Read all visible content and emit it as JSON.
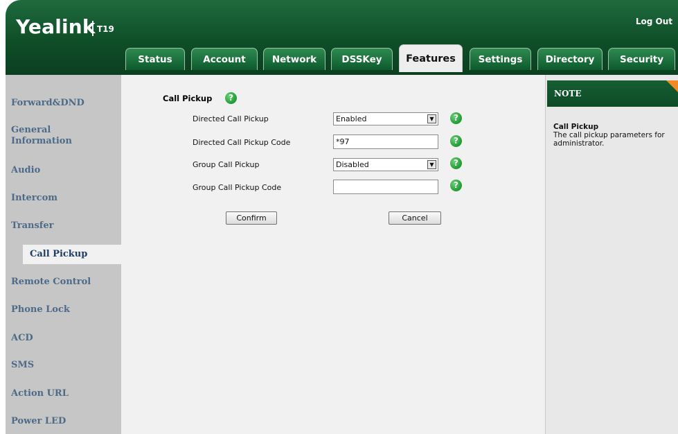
{
  "brand": {
    "name": "Yealink",
    "model": "T19"
  },
  "header": {
    "logout_label": "Log Out"
  },
  "tabs": [
    {
      "label": "Status",
      "active": false
    },
    {
      "label": "Account",
      "active": false
    },
    {
      "label": "Network",
      "active": false
    },
    {
      "label": "DSSKey",
      "active": false
    },
    {
      "label": "Features",
      "active": true
    },
    {
      "label": "Settings",
      "active": false
    },
    {
      "label": "Directory",
      "active": false
    },
    {
      "label": "Security",
      "active": false
    }
  ],
  "sidebar": {
    "items": [
      {
        "label": "Forward&DND"
      },
      {
        "label": "General\nInformation"
      },
      {
        "label": "Audio"
      },
      {
        "label": "Intercom"
      },
      {
        "label": "Transfer"
      },
      {
        "label": "Call Pickup",
        "active": true
      },
      {
        "label": "Remote Control"
      },
      {
        "label": "Phone Lock"
      },
      {
        "label": "ACD"
      },
      {
        "label": "SMS"
      },
      {
        "label": "Action URL"
      },
      {
        "label": "Power LED"
      }
    ]
  },
  "main": {
    "section_title": "Call Pickup",
    "fields": [
      {
        "label": "Directed Call Pickup",
        "type": "select",
        "value": "Enabled"
      },
      {
        "label": "Directed Call Pickup Code",
        "type": "input",
        "value": "*97"
      },
      {
        "label": "Group Call Pickup",
        "type": "select",
        "value": "Disabled"
      },
      {
        "label": "Group Call Pickup Code",
        "type": "input",
        "value": ""
      }
    ],
    "confirm_label": "Confirm",
    "cancel_label": "Cancel"
  },
  "note": {
    "title": "NOTE",
    "heading": "Call Pickup",
    "body": "The call pickup parameters for administrator."
  },
  "colors": {
    "header_green": "#0f4e28",
    "sidebar_bg": "#c6c6c6",
    "sidebar_text": "#4d6a88",
    "help_icon": "#26a23b",
    "note_corner": "#f08a24"
  }
}
